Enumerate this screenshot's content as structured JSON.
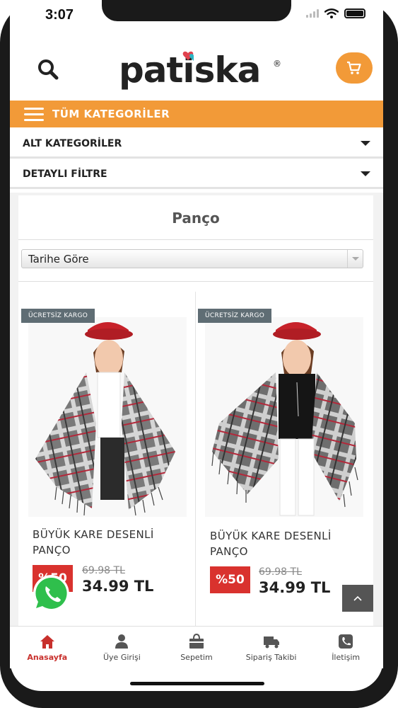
{
  "status_bar": {
    "time": "3:07"
  },
  "header": {
    "brand": "patiska",
    "brand_mark": "®"
  },
  "category_bar": {
    "label": "TÜM KATEGORİLER"
  },
  "filters": [
    {
      "label": "ALT KATEGORİLER"
    },
    {
      "label": "DETAYLI FİLTRE"
    }
  ],
  "page": {
    "title": "Panço"
  },
  "sort": {
    "selected": "Tarihe Göre"
  },
  "products": [
    {
      "badge": "ÜCRETSİZ KARGO",
      "name": "BÜYÜK KARE DESENLİ PANÇO",
      "discount": "%50",
      "old_price": "69.98 TL",
      "price": "34.99 TL",
      "top_color": "#ffffff"
    },
    {
      "badge": "ÜCRETSİZ KARGO",
      "name": "BÜYÜK KARE DESENLİ PANÇO",
      "discount": "%50",
      "old_price": "69.98 TL",
      "price": "34.99 TL",
      "top_color": "#111111"
    }
  ],
  "bottom_nav": [
    {
      "label": "Anasayfa",
      "icon": "home-icon",
      "active": true
    },
    {
      "label": "Üye Girişi",
      "icon": "user-icon",
      "active": false
    },
    {
      "label": "Sepetim",
      "icon": "bag-icon",
      "active": false
    },
    {
      "label": "Sipariş Takibi",
      "icon": "truck-icon",
      "active": false
    },
    {
      "label": "İletişim",
      "icon": "phone-icon",
      "active": false
    }
  ],
  "colors": {
    "accent": "#f29a38",
    "discount": "#d9322e",
    "active_nav": "#c8302c",
    "badge": "#5f6d74"
  }
}
